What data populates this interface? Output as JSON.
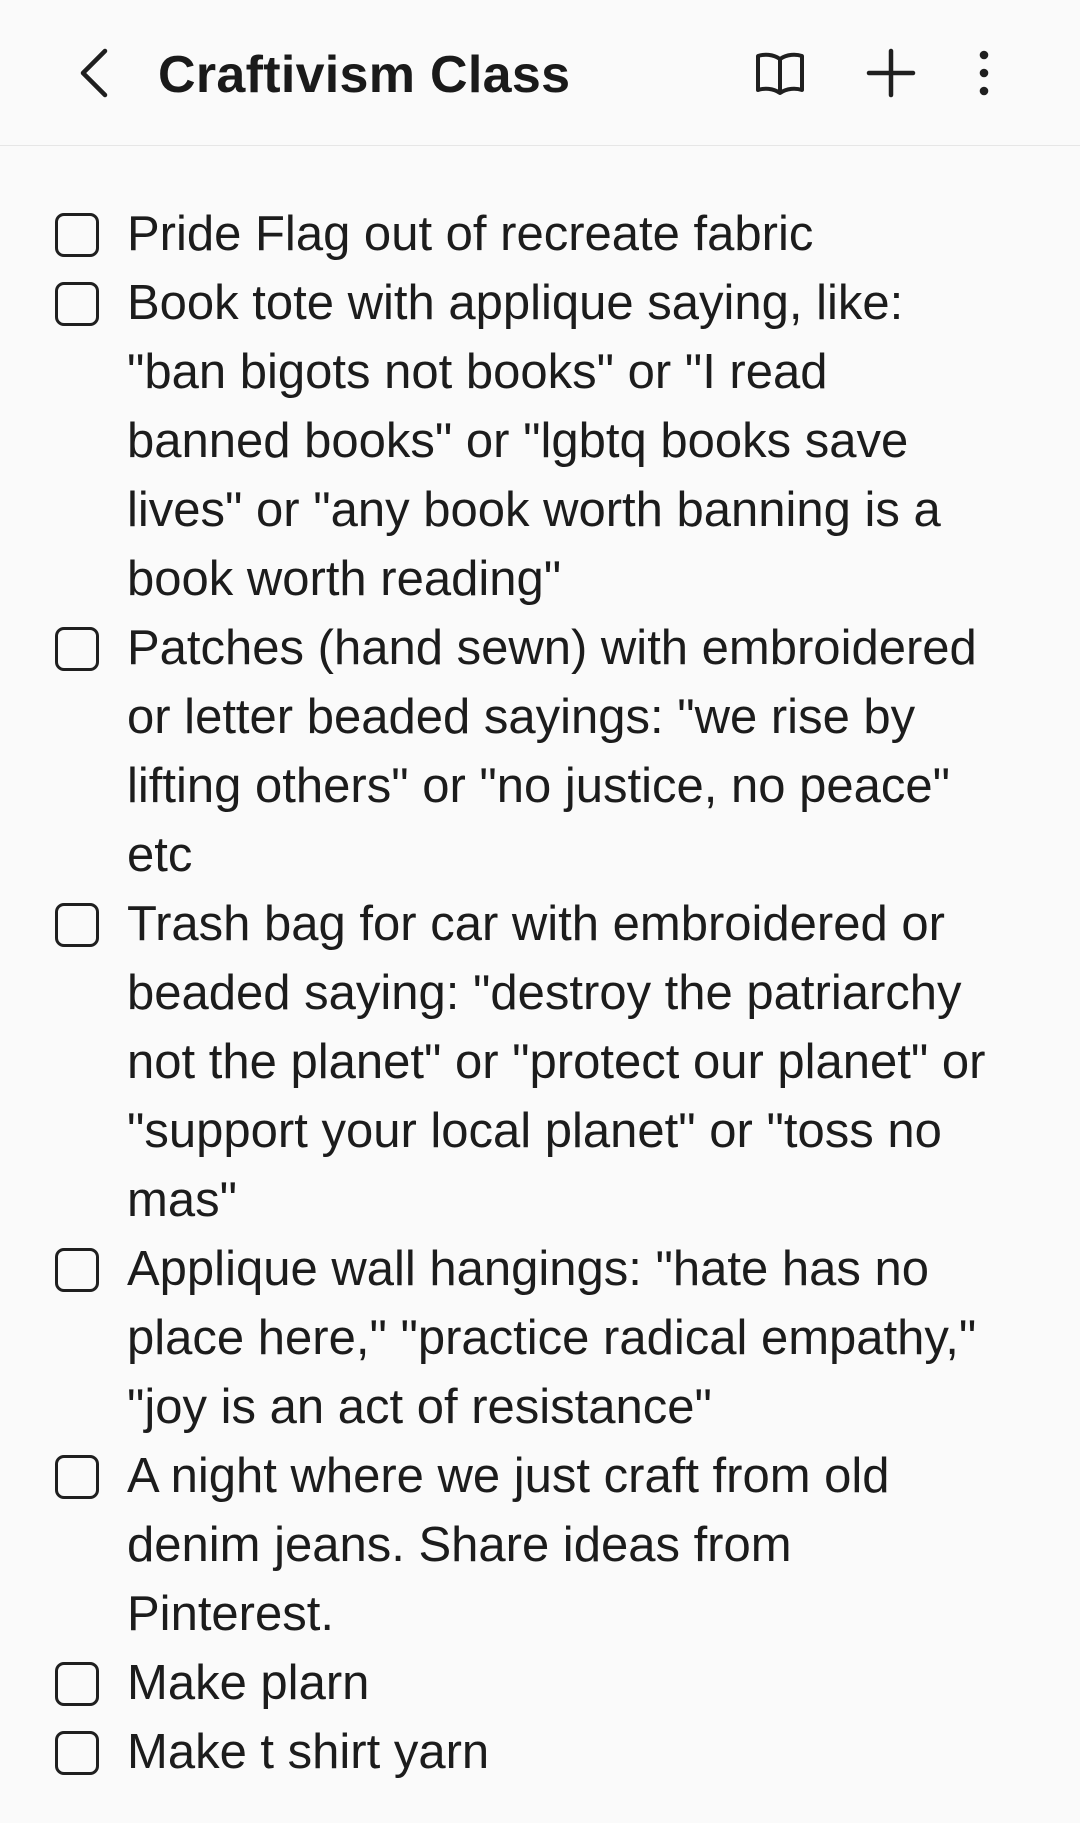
{
  "header": {
    "title": "Craftivism Class",
    "back_icon": "chevron-left-icon",
    "actions": [
      {
        "name": "reading-mode-button",
        "icon": "open-book-icon"
      },
      {
        "name": "add-button",
        "icon": "plus-icon"
      },
      {
        "name": "more-options-button",
        "icon": "kebab-menu-icon"
      }
    ]
  },
  "checklist": {
    "items": [
      {
        "checked": false,
        "lines": [
          "Pride Flag out of recreate fabric"
        ]
      },
      {
        "checked": false,
        "lines": [
          "Book tote with applique saying, like:",
          "\"ban bigots not books\" or \"I read",
          "banned books\" or \"lgbtq books save",
          "lives\" or \"any book worth banning is a",
          "book worth reading\""
        ]
      },
      {
        "checked": false,
        "lines": [
          "Patches (hand sewn) with embroidered",
          "or letter beaded sayings: \"we rise by",
          "lifting others\" or \"no justice, no peace\"",
          "etc"
        ]
      },
      {
        "checked": false,
        "lines": [
          "Trash bag for car with embroidered or",
          "beaded saying: \"destroy the patriarchy",
          "not the planet\" or \"protect our planet\" or",
          "\"support your local planet\" or \"toss no",
          "mas\""
        ]
      },
      {
        "checked": false,
        "lines": [
          "Applique wall hangings: \"hate has no",
          "place here,\" \"practice radical empathy,\"",
          "\"joy is an act of resistance\""
        ]
      },
      {
        "checked": false,
        "lines": [
          "A night where we just craft from old",
          "denim jeans. Share ideas from",
          "Pinterest."
        ]
      },
      {
        "checked": false,
        "lines": [
          "Make plarn"
        ]
      },
      {
        "checked": false,
        "lines": [
          "Make t shirt yarn"
        ]
      }
    ]
  }
}
